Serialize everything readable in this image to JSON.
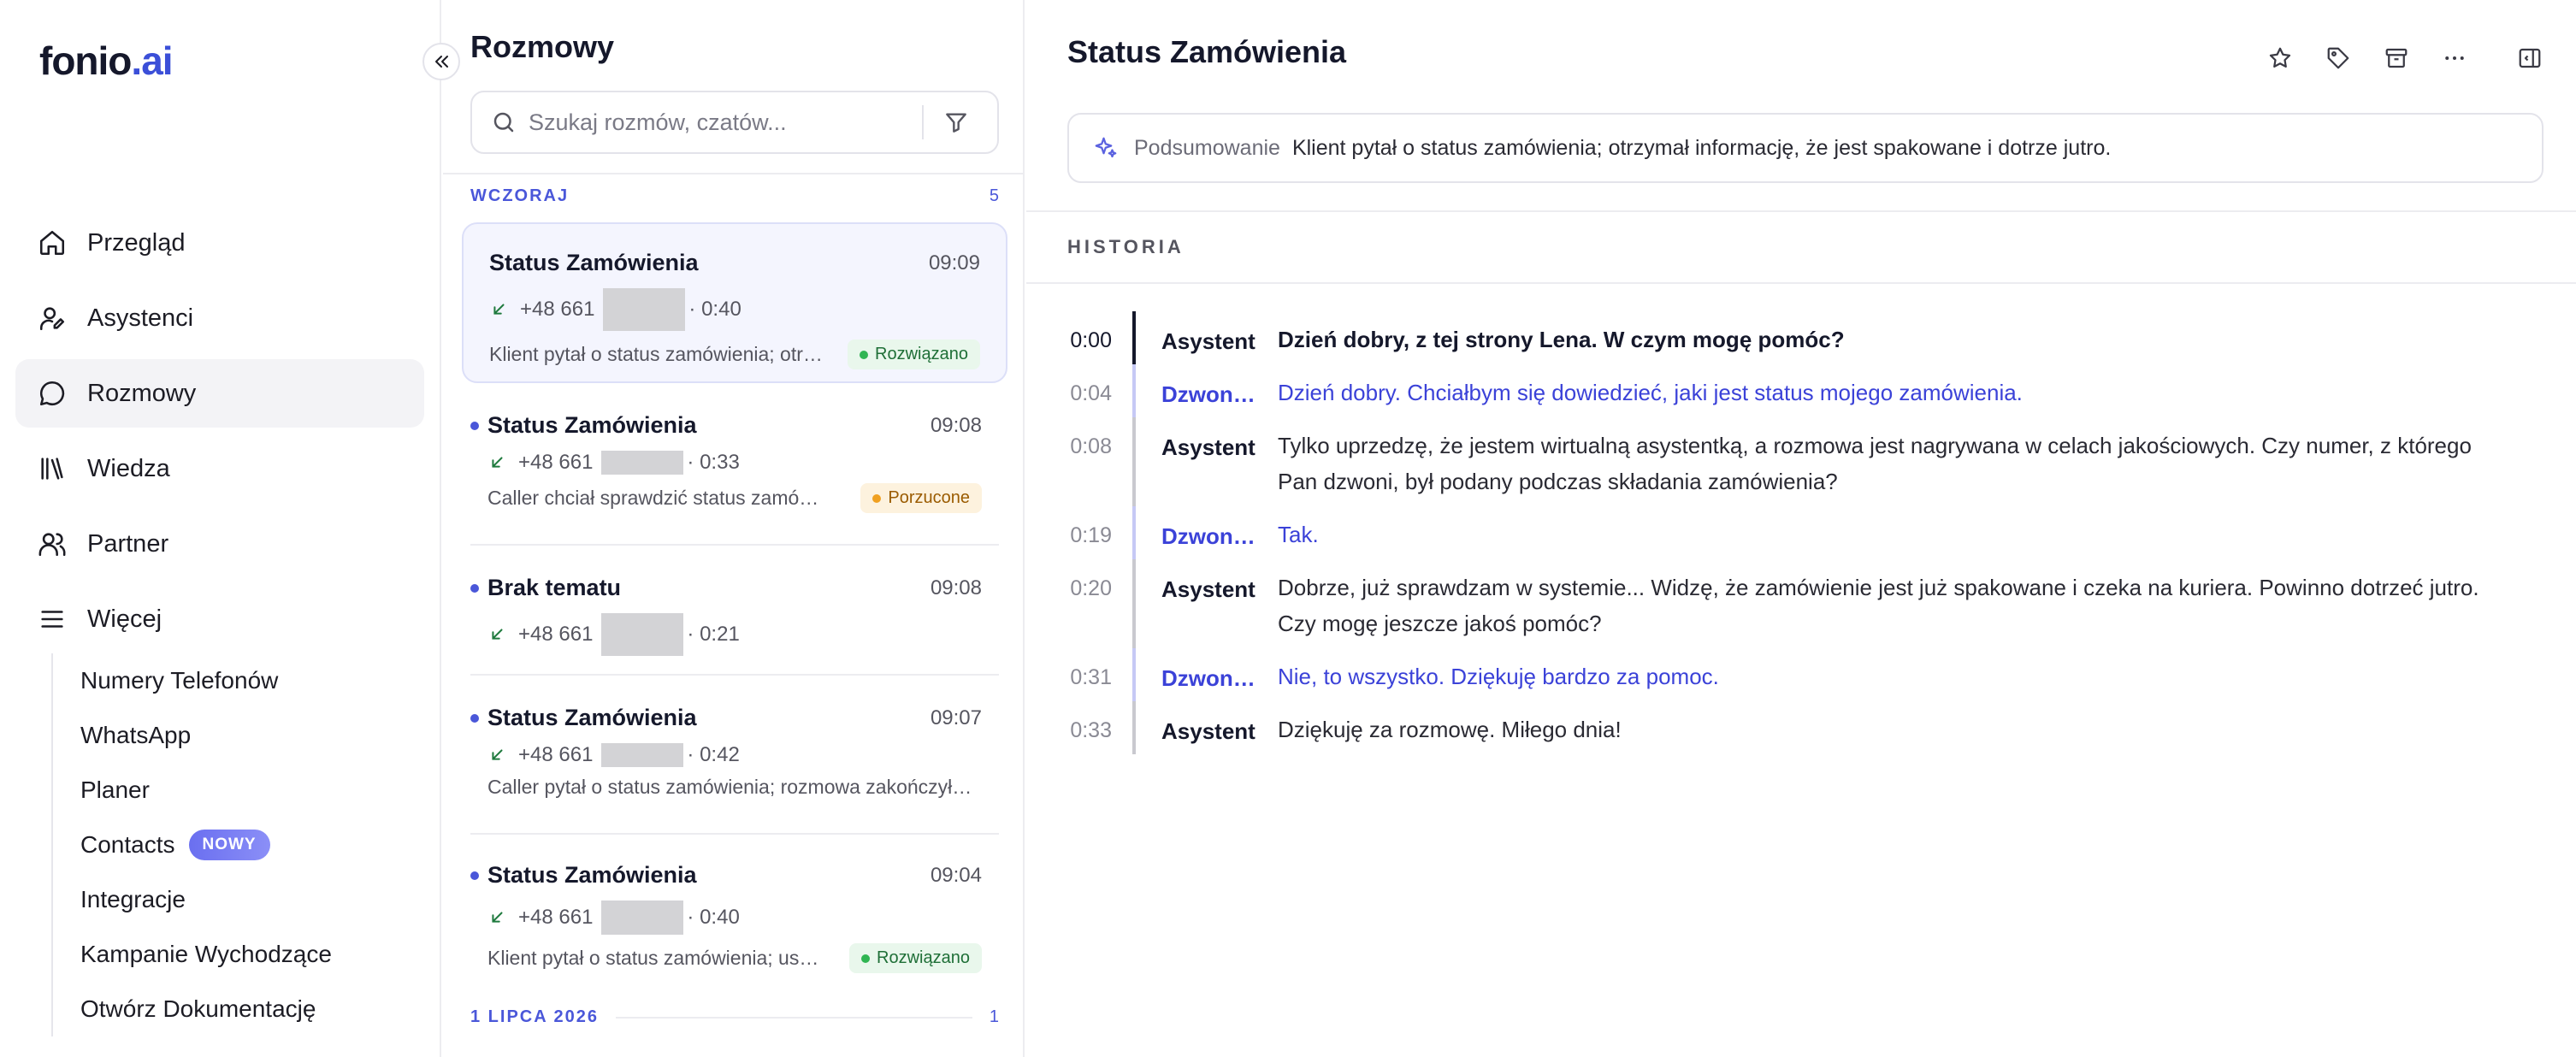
{
  "logo": {
    "brand": "fonio",
    "dot": ".",
    "ai": "ai"
  },
  "nav": {
    "items": [
      {
        "id": "overview",
        "label": "Przegląd",
        "icon": "home-icon"
      },
      {
        "id": "assistants",
        "label": "Asystenci",
        "icon": "assistant-icon"
      },
      {
        "id": "conversations",
        "label": "Rozmowy",
        "icon": "chat-bubble-icon",
        "active": true
      },
      {
        "id": "knowledge",
        "label": "Wiedza",
        "icon": "library-icon"
      },
      {
        "id": "partner",
        "label": "Partner",
        "icon": "users-icon"
      },
      {
        "id": "more",
        "label": "Więcej",
        "icon": "menu-icon"
      }
    ],
    "sub_items": [
      {
        "label": "Numery Telefonów"
      },
      {
        "label": "WhatsApp"
      },
      {
        "label": "Planer"
      },
      {
        "label": "Contacts",
        "badge": "NOWY"
      },
      {
        "label": "Integracje"
      },
      {
        "label": "Kampanie Wychodzące"
      },
      {
        "label": "Otwórz Dokumentację"
      }
    ]
  },
  "list": {
    "title": "Rozmowy",
    "search_placeholder": "Szukaj rozmów, czatów...",
    "groups": [
      {
        "label": "WCZORAJ",
        "count": "5"
      },
      {
        "label": "1 LIPCA 2026",
        "count": "1"
      }
    ],
    "conversations": [
      {
        "title": "Status Zamówienia",
        "time": "09:09",
        "phone": "+48 661",
        "duration": "· 0:40",
        "preview": "Klient pytał o status zamówienia; otrzymał informację, że jest spakowane i dotrze jutro.",
        "status": "Rozwiązano",
        "status_type": "ok",
        "unread": false,
        "selected": true
      },
      {
        "title": "Status Zamówienia",
        "time": "09:08",
        "phone": "+48 661",
        "duration": "· 0:33",
        "preview": "Caller chciał sprawdzić status zamówienia, rozmowa przerwana.",
        "status": "Porzucone",
        "status_type": "warn",
        "unread": true,
        "selected": false
      },
      {
        "title": "Brak tematu",
        "time": "09:08",
        "phone": "+48 661",
        "duration": "· 0:21",
        "preview": "",
        "status": "",
        "status_type": "",
        "unread": true,
        "selected": false
      },
      {
        "title": "Status Zamówienia",
        "time": "09:07",
        "phone": "+48 661",
        "duration": "· 0:42",
        "preview": "Caller pytał o status zamówienia; rozmowa zakończyła się.",
        "status": "",
        "status_type": "",
        "unread": true,
        "selected": false
      },
      {
        "title": "Status Zamówienia",
        "time": "09:04",
        "phone": "+48 661",
        "duration": "· 0:40",
        "preview": "Klient pytał o status zamówienia; usłyszał, że zostanie dostarczone.",
        "status": "Rozwiązano",
        "status_type": "ok",
        "unread": true,
        "selected": false
      }
    ]
  },
  "detail": {
    "title": "Status Zamówienia",
    "summary_label": "Podsumowanie",
    "summary_text": "Klient pytał o status zamówienia; otrzymał informację, że jest spakowane i dotrze jutro.",
    "history_label": "HISTORIA",
    "transcript": [
      {
        "time": "0:00",
        "speaker": "Asystent",
        "role": "assistant",
        "text": "Dzień dobry, z tej strony Lena. W czym mogę pomóc?"
      },
      {
        "time": "0:04",
        "speaker": "Dzwoniący",
        "role": "caller",
        "text": "Dzień dobry. Chciałbym się dowiedzieć, jaki jest status mojego zamówienia."
      },
      {
        "time": "0:08",
        "speaker": "Asystent",
        "role": "assistant",
        "text": "Tylko uprzedzę, że jestem wirtualną asystentką, a rozmowa jest nagrywana w celach jakościowych. Czy numer, z którego Pan dzwoni, był podany podczas składania zamówienia?"
      },
      {
        "time": "0:19",
        "speaker": "Dzwoniący",
        "role": "caller",
        "text": "Tak."
      },
      {
        "time": "0:20",
        "speaker": "Asystent",
        "role": "assistant",
        "text": "Dobrze, już sprawdzam w systemie... Widzę, że zamówienie jest już spakowane i czeka na kuriera. Powinno dotrzeć jutro. Czy mogę jeszcze jakoś pomóc?"
      },
      {
        "time": "0:31",
        "speaker": "Dzwoniący",
        "role": "caller",
        "text": "Nie, to wszystko. Dziękuję bardzo za pomoc."
      },
      {
        "time": "0:33",
        "speaker": "Asystent",
        "role": "assistant",
        "text": "Dziękuję za rozmowę. Miłego dnia!"
      }
    ]
  },
  "colors": {
    "accent": "#3b42d8",
    "ok": "#2fb552",
    "warn": "#f0a020"
  }
}
